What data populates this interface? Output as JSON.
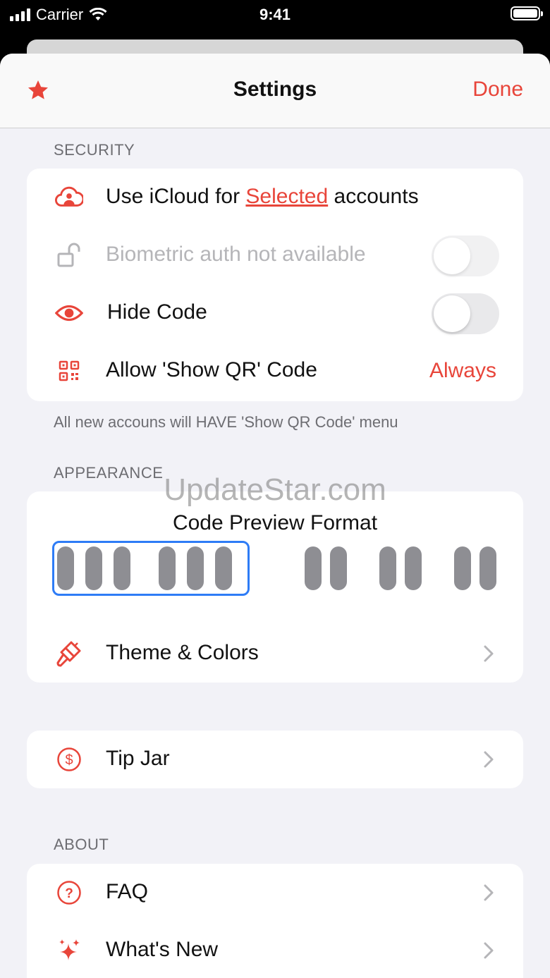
{
  "status_bar": {
    "carrier": "Carrier",
    "time": "9:41"
  },
  "nav": {
    "title": "Settings",
    "done_label": "Done"
  },
  "security": {
    "header": "SECURITY",
    "icloud": {
      "prefix": "Use iCloud for ",
      "link": "Selected",
      "suffix": " accounts"
    },
    "biometric_label": "Biometric auth not available",
    "hide_code_label": "Hide Code",
    "show_qr_label": "Allow 'Show QR' Code",
    "show_qr_value": "Always",
    "footer": "All new accouns will HAVE 'Show QR Code' menu"
  },
  "appearance": {
    "header": "APPEARANCE",
    "preview_title": "Code Preview Format",
    "theme_label": "Theme & Colors"
  },
  "tip_jar_label": "Tip Jar",
  "about": {
    "header": "ABOUT",
    "faq_label": "FAQ",
    "whats_new_label": "What's New"
  },
  "watermark": "UpdateStar.com",
  "colors": {
    "accent": "#e8453a",
    "selection": "#2e7cf6",
    "background": "#f2f2f7"
  }
}
